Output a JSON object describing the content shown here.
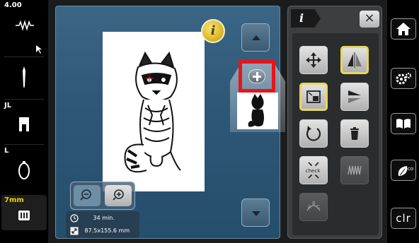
{
  "left_bar": {
    "tension_value": "4.00",
    "presser_foot_tag": "JL",
    "needle_plate_tag": "L",
    "stitch_length": "7mm"
  },
  "canvas": {
    "info_label": "i",
    "status": {
      "time": "34 min.",
      "size": "87.5x155.6 mm"
    }
  },
  "tool_panel": {
    "tab_label": "i",
    "close_label": "×",
    "check_label": "check"
  },
  "right_bar": {
    "clr_label": "clr",
    "eco_label": "eco"
  },
  "colors": {
    "highlight": "#e8141b",
    "active_border": "#e6d75c",
    "info_gold": "#d7b21d"
  }
}
